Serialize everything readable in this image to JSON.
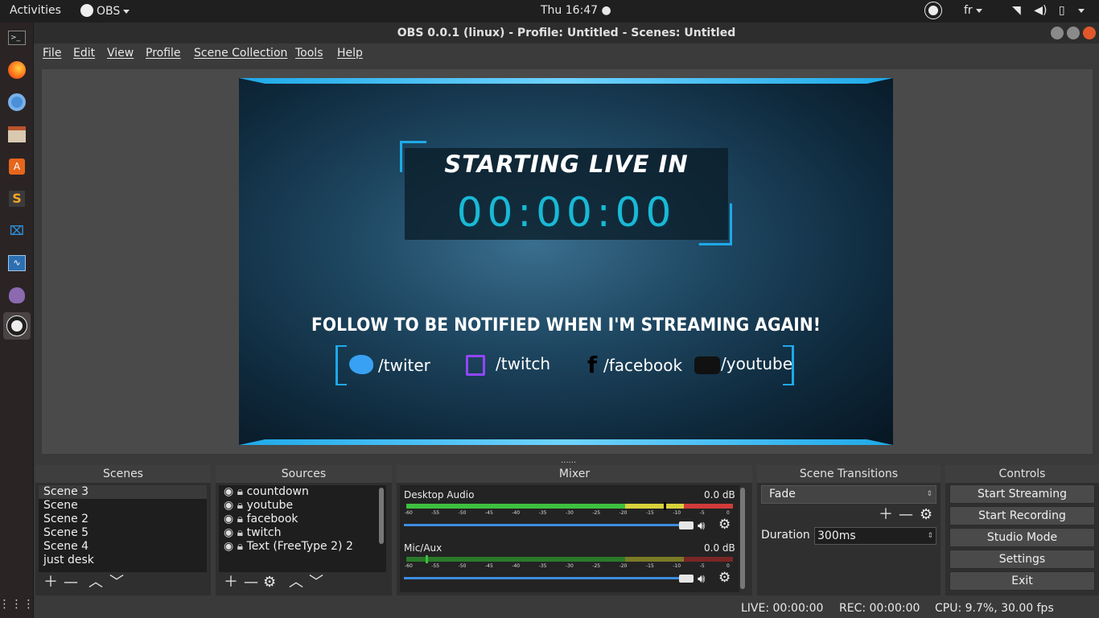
{
  "topbar": {
    "activities": "Activities",
    "app": "OBS",
    "clock": "Thu 16:47 ●",
    "lang": "fr"
  },
  "window": {
    "title": "OBS 0.0.1 (linux) - Profile: Untitled - Scenes: Untitled"
  },
  "menu": [
    "File",
    "Edit",
    "View",
    "Profile",
    "Scene Collection",
    "Tools",
    "Help"
  ],
  "preview": {
    "heading": "STARTING LIVE IN",
    "timer": "00:00:00",
    "follow": "FOLLOW TO BE NOTIFIED WHEN I'M STREAMING AGAIN!",
    "socials": [
      "/twiter",
      "/twitch",
      "/facebook",
      "/youtube"
    ]
  },
  "docks": {
    "scenes_title": "Scenes",
    "sources_title": "Sources",
    "mixer_title": "Mixer",
    "transitions_title": "Scene Transitions",
    "controls_title": "Controls"
  },
  "scenes": [
    "Scene 3",
    "Scene",
    "Scene 2",
    "Scene 5",
    "Scene 4",
    "just desk"
  ],
  "sources": [
    "countdown",
    "youtube",
    "facebook",
    "twitch",
    "Text (FreeType 2) 2"
  ],
  "mixer": {
    "tracks": [
      {
        "name": "Desktop Audio",
        "db": "0.0 dB"
      },
      {
        "name": "Mic/Aux",
        "db": "0.0 dB"
      }
    ],
    "scale": [
      "-60",
      "-55",
      "-50",
      "-45",
      "-40",
      "-35",
      "-30",
      "-25",
      "-20",
      "-15",
      "-10",
      "-5",
      "0"
    ]
  },
  "transitions": {
    "type": "Fade",
    "duration_label": "Duration",
    "duration": "300ms"
  },
  "controls": [
    "Start Streaming",
    "Start Recording",
    "Studio Mode",
    "Settings",
    "Exit"
  ],
  "status": {
    "live": "LIVE: 00:00:00",
    "rec": "REC: 00:00:00",
    "cpu": "CPU: 9.7%, 30.00 fps"
  },
  "colors": {
    "accent_cyan": "#1ea9e8",
    "timer_cyan": "#19b9d6",
    "meter_green": "#3fbf3f",
    "meter_yellow": "#d9d23c",
    "meter_red": "#d13b3b"
  }
}
